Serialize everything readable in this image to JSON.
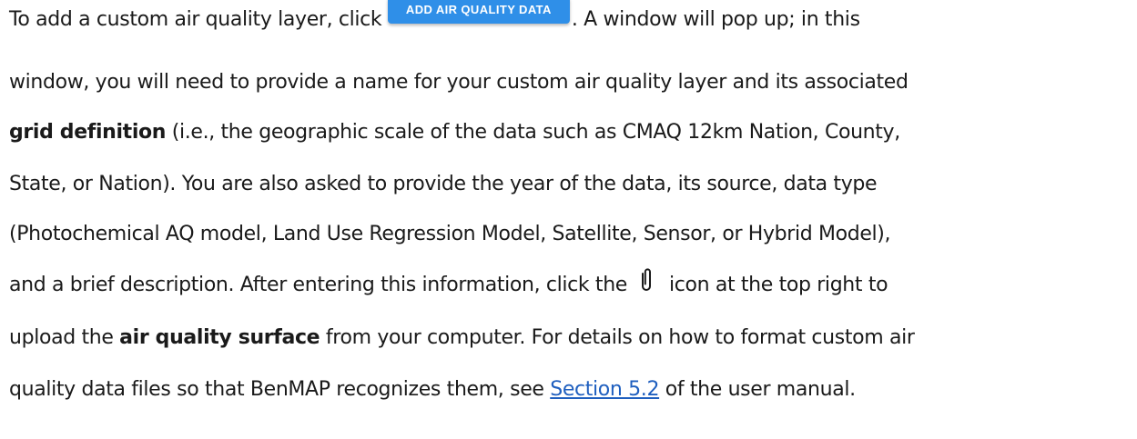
{
  "para": {
    "l1_a": "To add a custom air quality layer, click ",
    "button_label": "ADD AIR QUALITY DATA",
    "l1_b": ". A window will pop up; in this",
    "l2": "window, you will need to provide a name for your custom air quality layer and its associated",
    "l3_bold": "grid definition",
    "l3_rest": " (i.e., the geographic scale of the data such as CMAQ 12km Nation, County,",
    "l4": "State, or Nation). You are also asked to provide the year of the data, its source, data type",
    "l5": "(Photochemical AQ model, Land Use Regression Model, Satellite, Sensor, or Hybrid Model),",
    "l6_a": "and a brief description. After entering this information, click the",
    "icon": "paperclip-icon",
    "l6_b": "icon at the top right to",
    "l7_a": "upload the ",
    "l7_bold": "air quality surface",
    "l7_b": " from your computer. For details on how to format custom air",
    "l8_a": "quality data files so that BenMAP recognizes them, see ",
    "link": "Section 5.2",
    "l8_b": " of the user manual."
  },
  "colors": {
    "button_bg": "#2f8fe8",
    "link": "#1f5fbf",
    "text": "#1a1a1a"
  }
}
